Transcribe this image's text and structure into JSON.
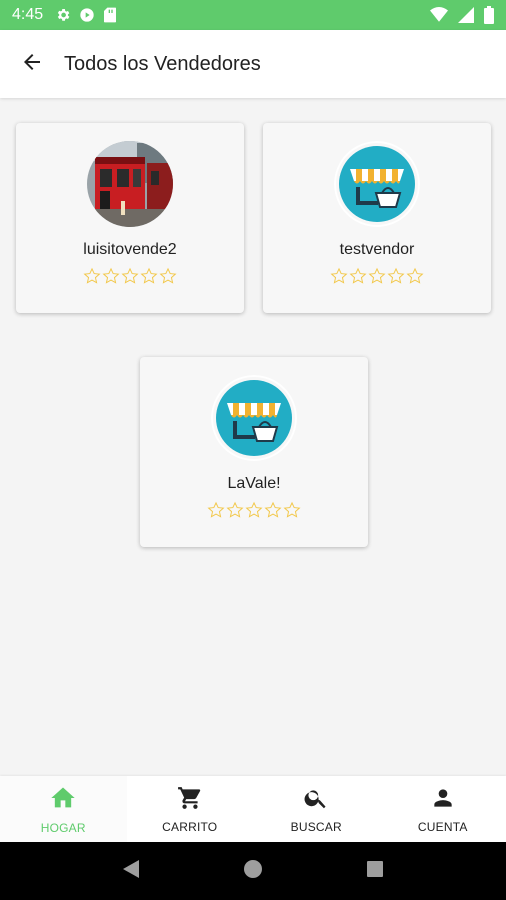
{
  "status_bar": {
    "time": "4:45",
    "left_icons": [
      "gear-icon",
      "play-icon",
      "sd-card-icon"
    ],
    "right_icons": [
      "wifi-icon",
      "signal-icon",
      "battery-icon"
    ],
    "color": "#5fcb6c"
  },
  "app_bar": {
    "title": "Todos los Vendedores",
    "back_icon": "arrow-back-icon"
  },
  "vendors": [
    {
      "name": "luisitovende2",
      "avatar": "storefront-photo",
      "rating": 0,
      "max_rating": 5
    },
    {
      "name": "testvendor",
      "avatar": "store-logo-icon",
      "rating": 0,
      "max_rating": 5
    },
    {
      "name": "LaVale!",
      "avatar": "store-logo-icon",
      "rating": 0,
      "max_rating": 5
    }
  ],
  "bottom_nav": {
    "items": [
      {
        "label": "HOGAR",
        "icon": "home-icon",
        "active": true
      },
      {
        "label": "CARRITO",
        "icon": "cart-icon",
        "active": false
      },
      {
        "label": "BUSCAR",
        "icon": "search-icon",
        "active": false
      },
      {
        "label": "CUENTA",
        "icon": "person-icon",
        "active": false
      }
    ]
  },
  "system_nav": [
    "back-triangle-icon",
    "home-circle-icon",
    "recents-square-icon"
  ],
  "colors": {
    "accent": "#5fcb6c",
    "star": "#f2c84b",
    "logo_bg": "#22adc5"
  }
}
